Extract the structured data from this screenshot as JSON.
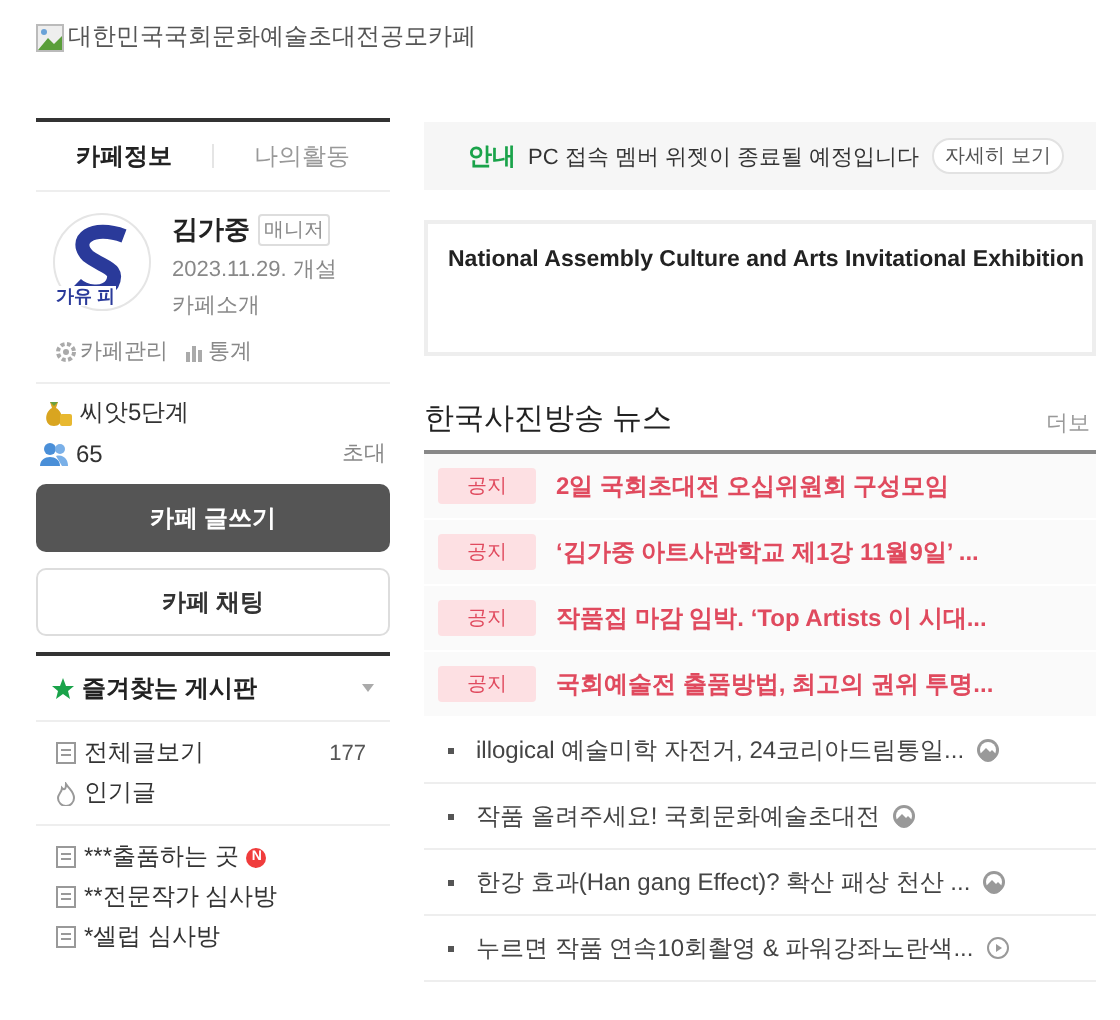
{
  "header": {
    "title": "대한민국국회문화예술초대전공모카페"
  },
  "sidebar": {
    "tabs": [
      {
        "label": "카페정보",
        "selected": true
      },
      {
        "label": "나의활동",
        "selected": false
      }
    ],
    "profile": {
      "logo_text": "가유 피",
      "name": "김가중",
      "role": "매니저",
      "created": "2023.11.29. 개설",
      "intro": "카페소개"
    },
    "admin_links": [
      {
        "label": "카페관리",
        "kind": "gear"
      },
      {
        "label": "통계",
        "kind": "chart"
      }
    ],
    "level": "씨앗5단계",
    "members": "65",
    "invite": "초대",
    "buttons": [
      {
        "label": "카페 글쓰기",
        "kind": "primary"
      },
      {
        "label": "카페 채팅",
        "kind": "secondary"
      }
    ],
    "favorites": {
      "title": "즐겨찾는 게시판"
    },
    "menu": [
      {
        "label": "전체글보기",
        "count": "177",
        "kind": "board"
      },
      {
        "label": "인기글",
        "kind": "popular"
      }
    ],
    "boards": [
      {
        "label": "***출품하는 곳",
        "badge": "N"
      },
      {
        "label": "**전문작가 심사방"
      },
      {
        "label": "*셀럽 심사방"
      }
    ]
  },
  "main": {
    "notice": {
      "tag": "안내",
      "text": "PC 접속 멤버 위젯이 종료될 예정입니다",
      "button": "자세히 보기"
    },
    "banner": "National Assembly Culture and Arts Invitational Exhibition",
    "news": {
      "title": "한국사진방송 뉴스",
      "more": "더보",
      "notices": [
        {
          "tag": "공지",
          "title": "2일 국회초대전 오십위원회 구성모임"
        },
        {
          "tag": "공지",
          "title": "‘김가중 아트사관학교 제1강 11월9일’ ..."
        },
        {
          "tag": "공지",
          "title": "작품집 마감 임박. ‘Top Artists 이 시대..."
        },
        {
          "tag": "공지",
          "title": "국회예술전 출품방법, 최고의 권위 투명..."
        }
      ],
      "posts": [
        {
          "title": "illogical 예술미학 자전거, 24코리아드림통일...",
          "kind": "image"
        },
        {
          "title": "작품 올려주세요! 국회문화예술초대전",
          "kind": "image"
        },
        {
          "title": "한강 효과(Han gang Effect)? 확산 패상 천산 ...",
          "kind": "image"
        },
        {
          "title": "누르면 작품 연속10회촬영 & 파워강좌노란색...",
          "kind": "video"
        }
      ]
    }
  }
}
